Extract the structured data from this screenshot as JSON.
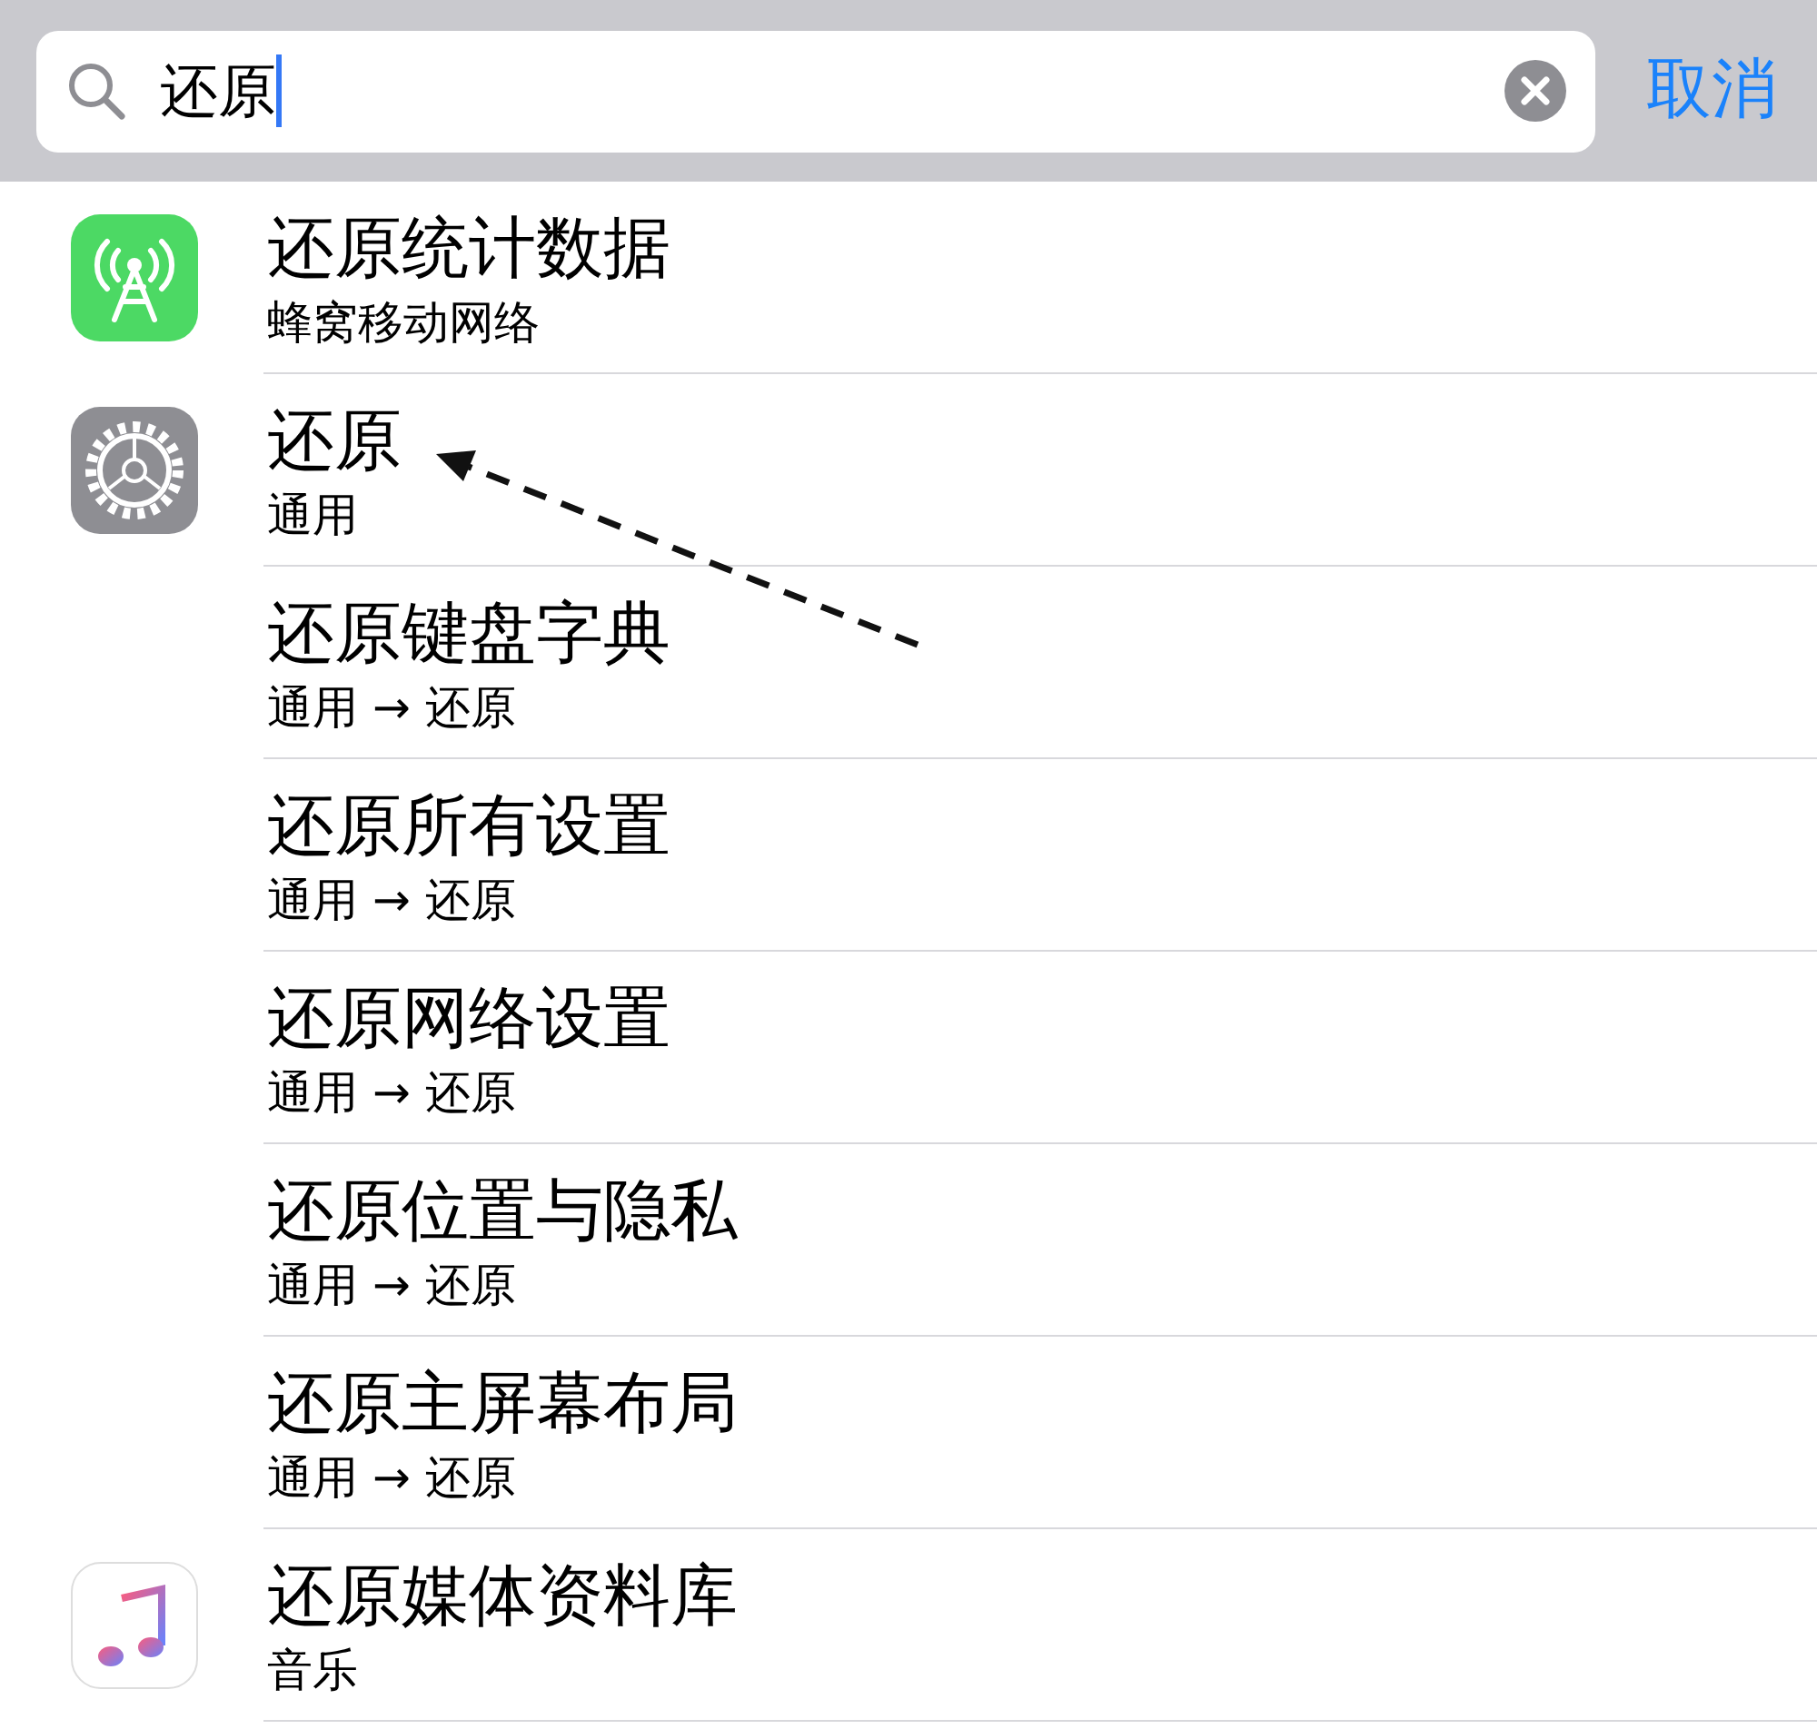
{
  "search": {
    "value": "还原",
    "cancel": "取消"
  },
  "results": [
    {
      "kind": "network",
      "title": "还原统计数据",
      "subtitle": "蜂窝移动网络"
    },
    {
      "kind": "general",
      "title": "还原",
      "subtitle": "通用"
    },
    {
      "kind": "plain",
      "title": "还原键盘字典",
      "subtitle": "通用 → 还原"
    },
    {
      "kind": "plain",
      "title": "还原所有设置",
      "subtitle": "通用 → 还原"
    },
    {
      "kind": "plain",
      "title": "还原网络设置",
      "subtitle": "通用 → 还原"
    },
    {
      "kind": "plain",
      "title": "还原位置与隐私",
      "subtitle": "通用 → 还原"
    },
    {
      "kind": "plain",
      "title": "还原主屏幕布局",
      "subtitle": "通用 → 还原"
    },
    {
      "kind": "music",
      "title": "还原媒体资料库",
      "subtitle": "音乐"
    }
  ]
}
